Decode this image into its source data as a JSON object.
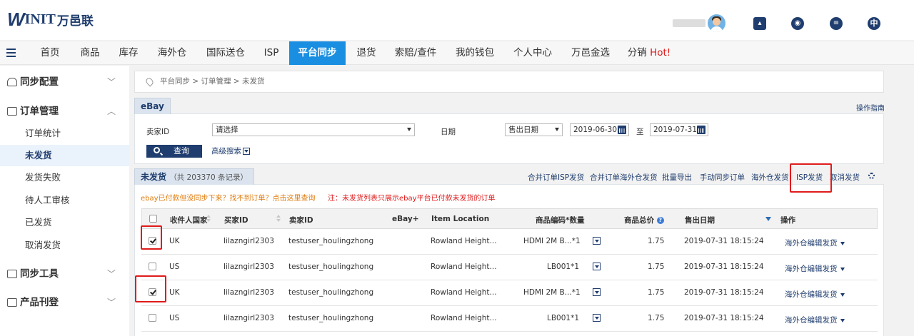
{
  "brand": {
    "logo_w": "W",
    "logo_int": "INIT",
    "logo_cn": "万邑联"
  },
  "top_icons": {
    "language": "中"
  },
  "nav": [
    {
      "label": "首页"
    },
    {
      "label": "商品"
    },
    {
      "label": "库存"
    },
    {
      "label": "海外仓"
    },
    {
      "label": "国际送仓"
    },
    {
      "label": "ISP"
    },
    {
      "label": "平台同步"
    },
    {
      "label": "退货"
    },
    {
      "label": "索赔/查件"
    },
    {
      "label": "我的钱包"
    },
    {
      "label": "个人中心"
    },
    {
      "label": "万邑金选"
    },
    {
      "label": "分销"
    }
  ],
  "nav_hot": "Hot!",
  "sidebar": {
    "sync_config": "同步配置",
    "order_mgmt": "订单管理",
    "items": [
      "订单统计",
      "未发货",
      "发货失败",
      "待人工审核",
      "已发货",
      "取消发货"
    ],
    "sync_tools": "同步工具",
    "product_listing": "产品刊登"
  },
  "breadcrumb": "平台同步 > 订单管理 > 未发货",
  "filter": {
    "tab": "eBay",
    "help": "操作指南",
    "seller_label": "卖家ID",
    "seller_value": "请选择",
    "date_label": "日期",
    "date_type": "售出日期",
    "date_from": "2019-06-30",
    "to": "至",
    "date_to": "2019-07-31",
    "query": "查询",
    "advanced": "高级搜索"
  },
  "list": {
    "tab": "未发货",
    "count": "（共 203370 条记录）",
    "actions": [
      "合并订单ISP发货",
      "合并订单海外仓发货",
      "批量导出",
      "手动同步订单",
      "海外仓发货",
      "ISP发货",
      "取消发货"
    ],
    "note_orange": "ebay已付款但没同步下来？找不到订单？点击这里查询",
    "note_red": "注：未发货列表只展示ebay平台已付款未发货的订单",
    "headers": {
      "country": "收件人国家",
      "buyer": "买家ID",
      "seller": "卖家ID",
      "ebay": "eBay+",
      "location": "Item Location",
      "sku": "商品编码*数量",
      "total": "商品总价",
      "date": "售出日期",
      "op": "操作",
      "help_q": "?"
    },
    "rows": [
      {
        "checked": true,
        "country": "UK",
        "buyer": "lilazngirl2303",
        "seller": "testuser_houlingzhong",
        "location": "Rowland Height...",
        "sku": "HDMI 2M B...*1",
        "total": "1.75",
        "date": "2019-07-31 18:15:24",
        "op": "海外仓编辑发货"
      },
      {
        "checked": false,
        "country": "US",
        "buyer": "lilazngirl2303",
        "seller": "testuser_houlingzhong",
        "location": "Rowland Height...",
        "sku": "LB001*1",
        "total": "1.75",
        "date": "2019-07-31 18:15:24",
        "op": "海外仓编辑发货"
      },
      {
        "checked": true,
        "country": "UK",
        "buyer": "lilazngirl2303",
        "seller": "testuser_houlingzhong",
        "location": "Rowland Height...",
        "sku": "HDMI 2M B...*1",
        "total": "1.75",
        "date": "2019-07-31 18:15:24",
        "op": "海外仓编辑发货"
      },
      {
        "checked": false,
        "country": "US",
        "buyer": "lilazngirl2303",
        "seller": "testuser_houlingzhong",
        "location": "Rowland Height...",
        "sku": "LB001*1",
        "total": "1.75",
        "date": "2019-07-31 18:15:24",
        "op": "海外仓编辑发货"
      }
    ]
  },
  "colors": {
    "brand": "#1f3d6e",
    "active_tab": "#1a8ee1",
    "highlight": "#e01b1b",
    "warning": "#e07b0c"
  }
}
